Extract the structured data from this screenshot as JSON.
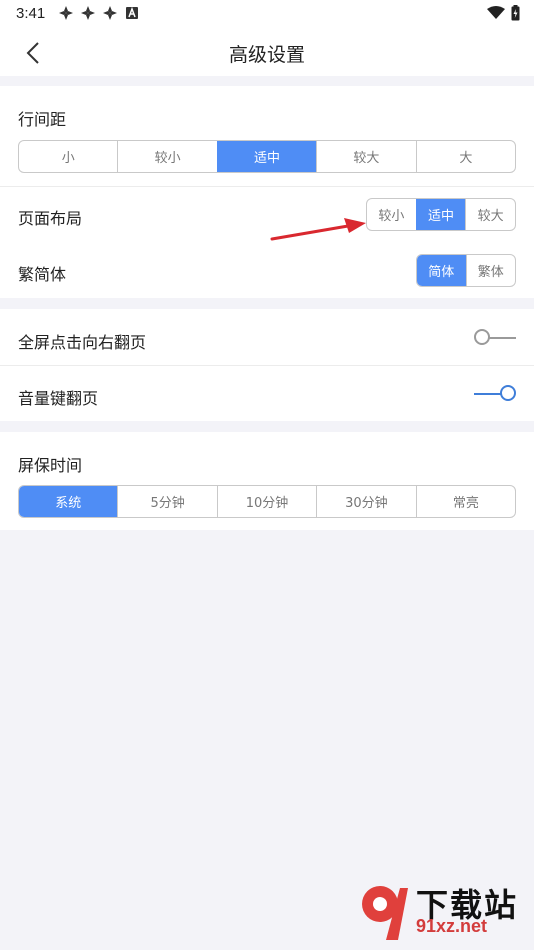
{
  "status_bar": {
    "time": "3:41"
  },
  "header": {
    "title": "高级设置"
  },
  "line_spacing": {
    "label": "行间距",
    "options": [
      "小",
      "较小",
      "适中",
      "较大",
      "大"
    ],
    "selected_index": 2
  },
  "page_layout": {
    "label": "页面布局",
    "options": [
      "较小",
      "适中",
      "较大"
    ],
    "selected_index": 1
  },
  "script_type": {
    "label": "繁简体",
    "options": [
      "简体",
      "繁体"
    ],
    "selected_index": 0
  },
  "fullscreen_tap": {
    "label": "全屏点击向右翻页",
    "enabled": false
  },
  "volume_key": {
    "label": "音量键翻页",
    "enabled": true
  },
  "screen_timeout": {
    "label": "屏保时间",
    "options": [
      "系统",
      "5分钟",
      "10分钟",
      "30分钟",
      "常亮"
    ],
    "selected_index": 0
  },
  "watermark": {
    "brand": "下载站",
    "site": "91xz.net"
  },
  "colors": {
    "accent": "#4f8df5",
    "toggle_on": "#3f7ed9",
    "arrow": "#d9282f"
  }
}
